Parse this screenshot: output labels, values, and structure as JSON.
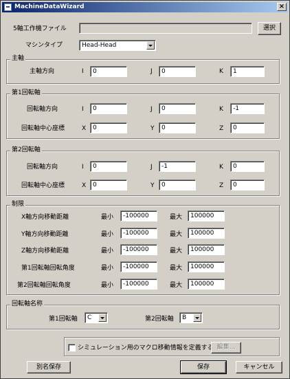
{
  "window": {
    "title": "MachineDataWizard",
    "close": "×"
  },
  "file": {
    "label": "5軸工作機ファイル",
    "value": "",
    "select_button": "選択"
  },
  "machine_type": {
    "label": "マシンタイプ",
    "selected": "Head-Head"
  },
  "spindle": {
    "title": "主軸",
    "direction_label": "主軸方向",
    "i": {
      "label": "I",
      "value": "0"
    },
    "j": {
      "label": "J",
      "value": "0"
    },
    "k": {
      "label": "K",
      "value": "1"
    }
  },
  "rot1": {
    "title": "第1回転軸",
    "direction_label": "回転軸方向",
    "i": {
      "label": "I",
      "value": "0"
    },
    "j": {
      "label": "J",
      "value": "0"
    },
    "k": {
      "label": "K",
      "value": "-1"
    },
    "center_label": "回転軸中心座標",
    "x": {
      "label": "X",
      "value": "0"
    },
    "y": {
      "label": "Y",
      "value": "0"
    },
    "z": {
      "label": "Z",
      "value": "0"
    }
  },
  "rot2": {
    "title": "第2回転軸",
    "direction_label": "回転軸方向",
    "i": {
      "label": "I",
      "value": "0"
    },
    "j": {
      "label": "J",
      "value": "-1"
    },
    "k": {
      "label": "K",
      "value": "0"
    },
    "center_label": "回転軸中心座標",
    "x": {
      "label": "X",
      "value": "0"
    },
    "y": {
      "label": "Y",
      "value": "0"
    },
    "z": {
      "label": "Z",
      "value": "0"
    }
  },
  "limits": {
    "title": "制限",
    "min_label": "最小",
    "max_label": "最大",
    "rows": [
      {
        "label": "X軸方向移動距離",
        "min": "-100000",
        "max": "100000"
      },
      {
        "label": "Y軸方向移動距離",
        "min": "-100000",
        "max": "100000"
      },
      {
        "label": "Z軸方向移動距離",
        "min": "-100000",
        "max": "100000"
      },
      {
        "label": "第1回転軸回転角度",
        "min": "-100000",
        "max": "100000"
      },
      {
        "label": "第2回転軸回転角度",
        "min": "-100000",
        "max": "100000"
      }
    ]
  },
  "axis_names": {
    "title": "回転軸名称",
    "axis1_label": "第1回転軸",
    "axis1_value": "C",
    "axis2_label": "第2回転軸",
    "axis2_value": "B"
  },
  "simulation": {
    "checkbox_label": "シミュレーション用のマクロ移動情報を定義する",
    "checked": false,
    "edit_button": "編集..."
  },
  "footer": {
    "save_as": "別名保存",
    "save": "保存",
    "cancel": "キャンセル"
  }
}
